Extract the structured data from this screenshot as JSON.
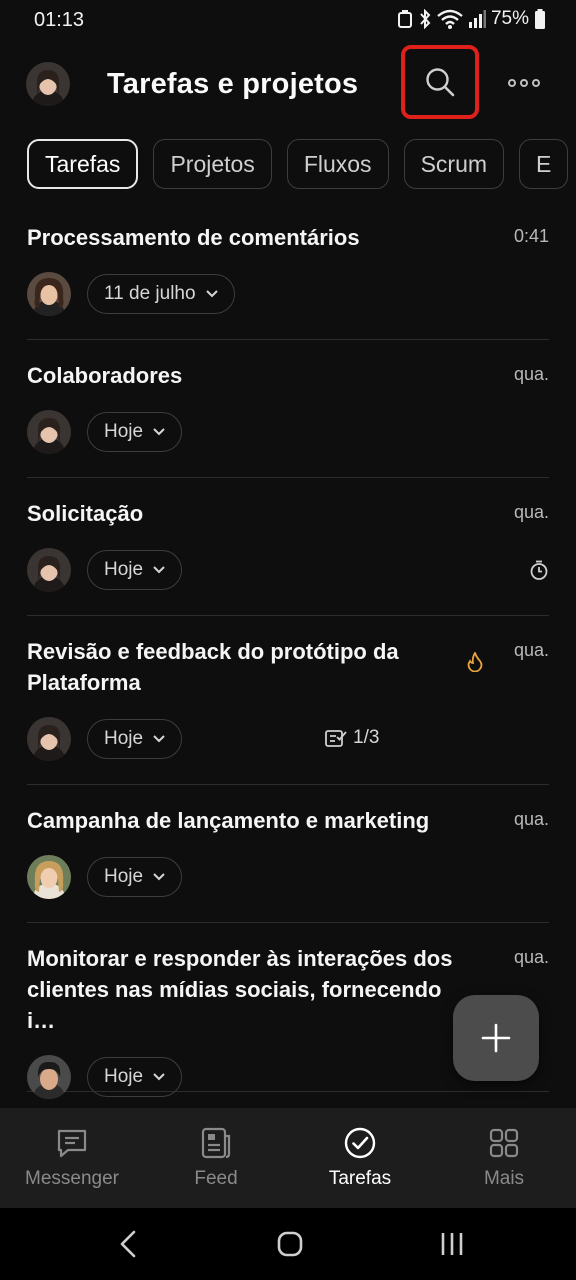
{
  "status_bar": {
    "time": "01:13",
    "battery": "75%"
  },
  "header": {
    "title": "Tarefas e projetos"
  },
  "tabs": [
    {
      "label": "Tarefas",
      "active": true
    },
    {
      "label": "Projetos",
      "active": false
    },
    {
      "label": "Fluxos",
      "active": false
    },
    {
      "label": "Scrum",
      "active": false
    },
    {
      "label": "E",
      "active": false
    }
  ],
  "tasks": [
    {
      "title": "Processamento de comentários",
      "time": "0:41",
      "date_chip": "11 de julho",
      "avatar": "woman-curly"
    },
    {
      "title": "Colaboradores",
      "time": "qua.",
      "date_chip": "Hoje",
      "avatar": "woman-dark"
    },
    {
      "title": "Solicitação",
      "time": "qua.",
      "date_chip": "Hoje",
      "avatar": "woman-dark",
      "icon": "timer-icon"
    },
    {
      "title": "Revisão e feedback do protótipo da Plataforma",
      "time": "qua.",
      "date_chip": "Hoje",
      "avatar": "woman-dark",
      "icon": "fire-icon",
      "checklist": "1/3"
    },
    {
      "title": "Campanha de lançamento e marketing",
      "time": "qua.",
      "date_chip": "Hoje",
      "avatar": "woman-blonde"
    },
    {
      "title": "Monitorar e responder às interações dos clientes nas mídias sociais, fornecendo i…",
      "time": "qua.",
      "date_chip": "Hoje",
      "avatar": "man-dark"
    }
  ],
  "bottom_nav": [
    {
      "label": "Messenger",
      "icon": "chat-icon",
      "active": false
    },
    {
      "label": "Feed",
      "icon": "feed-icon",
      "active": false
    },
    {
      "label": "Tarefas",
      "icon": "check-circle-icon",
      "active": true
    },
    {
      "label": "Mais",
      "icon": "grid-icon",
      "active": false
    }
  ],
  "colors": {
    "background": "#0e0e0e",
    "highlight": "#e0201a",
    "fire": "#e8a33c"
  }
}
